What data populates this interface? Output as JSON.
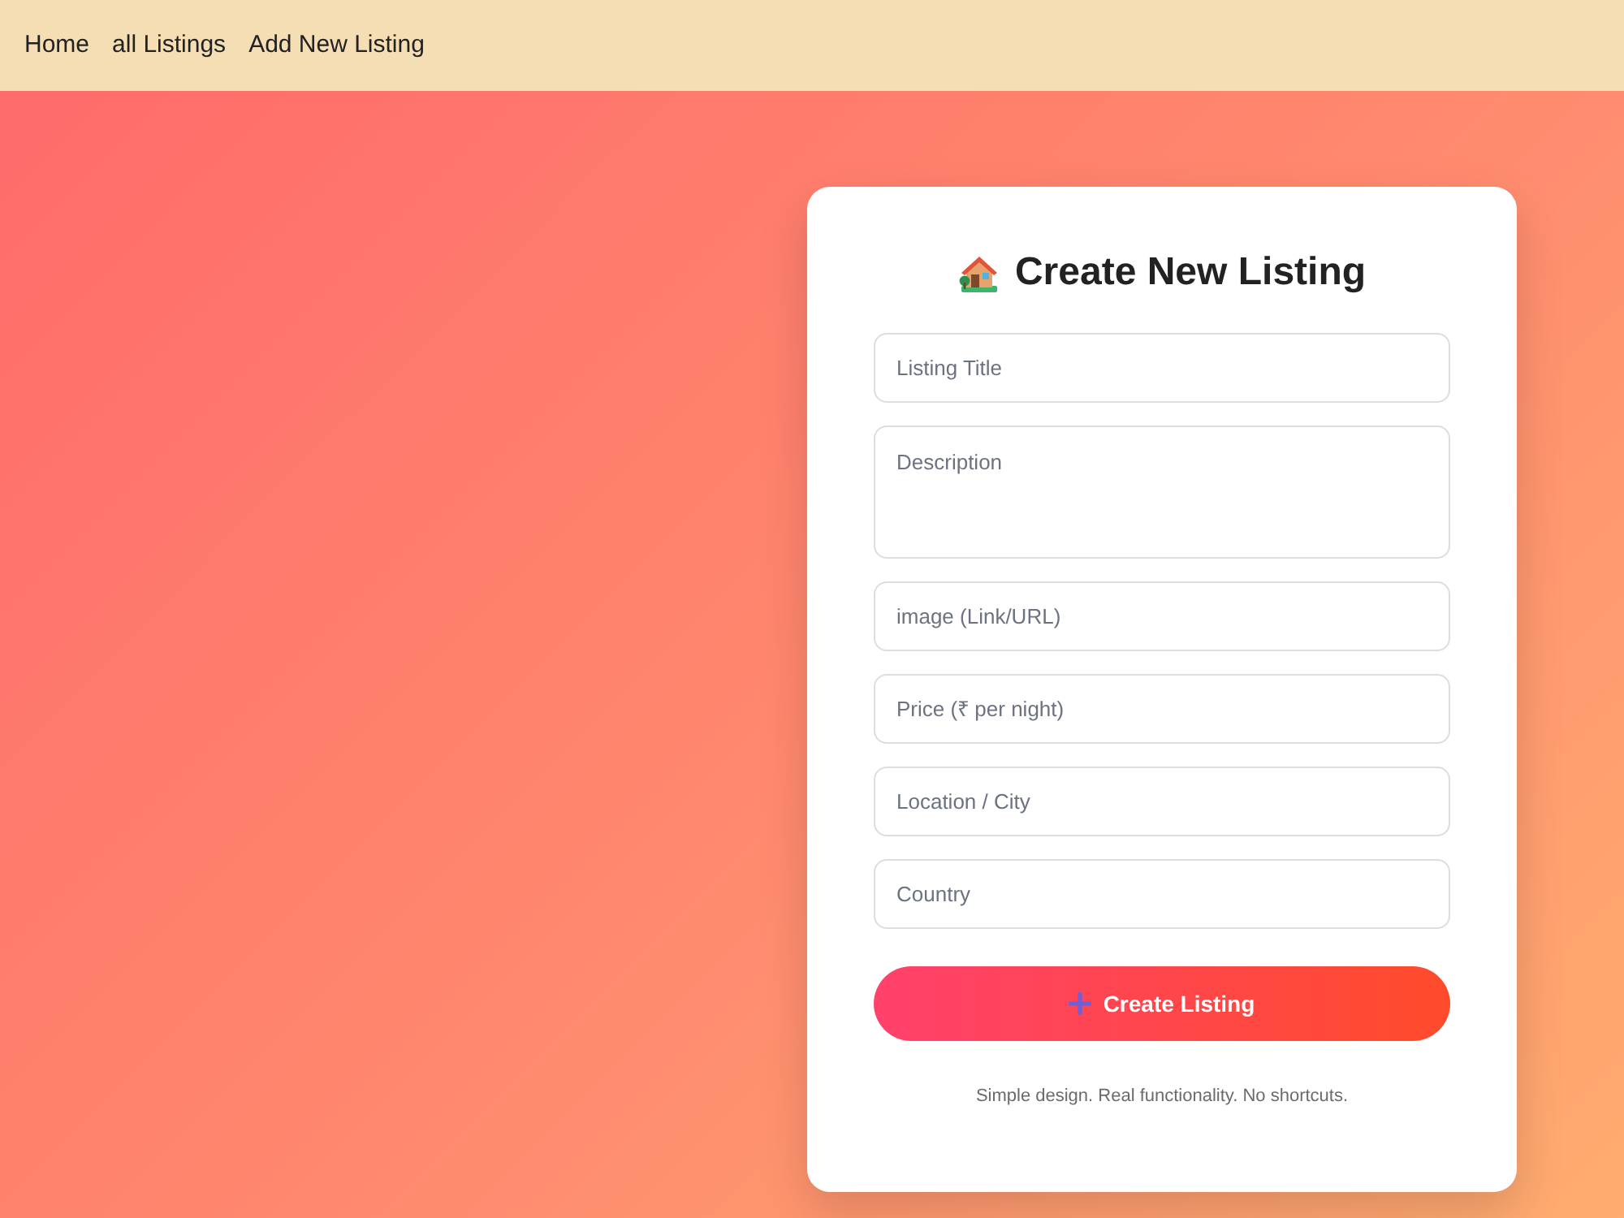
{
  "nav": {
    "links": [
      {
        "label": "Home"
      },
      {
        "label": "all Listings"
      },
      {
        "label": "Add New Listing"
      }
    ]
  },
  "form": {
    "title": "Create New Listing",
    "fields": [
      {
        "kind": "input",
        "placeholder": "Listing Title"
      },
      {
        "kind": "textarea",
        "placeholder": "Description"
      },
      {
        "kind": "input",
        "placeholder": "image (Link/URL)"
      },
      {
        "kind": "input",
        "placeholder": "Price (₹ per night)"
      },
      {
        "kind": "input",
        "placeholder": "Location / City"
      },
      {
        "kind": "input",
        "placeholder": "Country"
      }
    ],
    "submit": {
      "label": "Create Listing"
    },
    "footnote": "Simple design. Real functionality. No shortcuts."
  }
}
